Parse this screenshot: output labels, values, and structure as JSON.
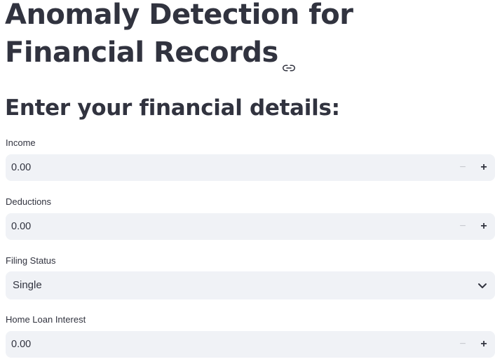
{
  "page": {
    "title": "Anomaly Detection for Financial Records",
    "title_anchor_icon": "link-icon",
    "subheader": "Enter your financial details:"
  },
  "form": {
    "income": {
      "label": "Income",
      "value": "0.00",
      "decrement_icon": "minus-icon",
      "increment_icon": "plus-icon"
    },
    "deductions": {
      "label": "Deductions",
      "value": "0.00",
      "decrement_icon": "minus-icon",
      "increment_icon": "plus-icon"
    },
    "filing_status": {
      "label": "Filing Status",
      "selected": "Single",
      "dropdown_icon": "chevron-down-icon"
    },
    "home_loan_interest": {
      "label": "Home Loan Interest",
      "value": "0.00",
      "decrement_icon": "minus-icon",
      "increment_icon": "plus-icon"
    }
  },
  "colors": {
    "text": "#31333f",
    "input_background": "#f0f2f6",
    "disabled_stepper": "#c8cad0"
  }
}
